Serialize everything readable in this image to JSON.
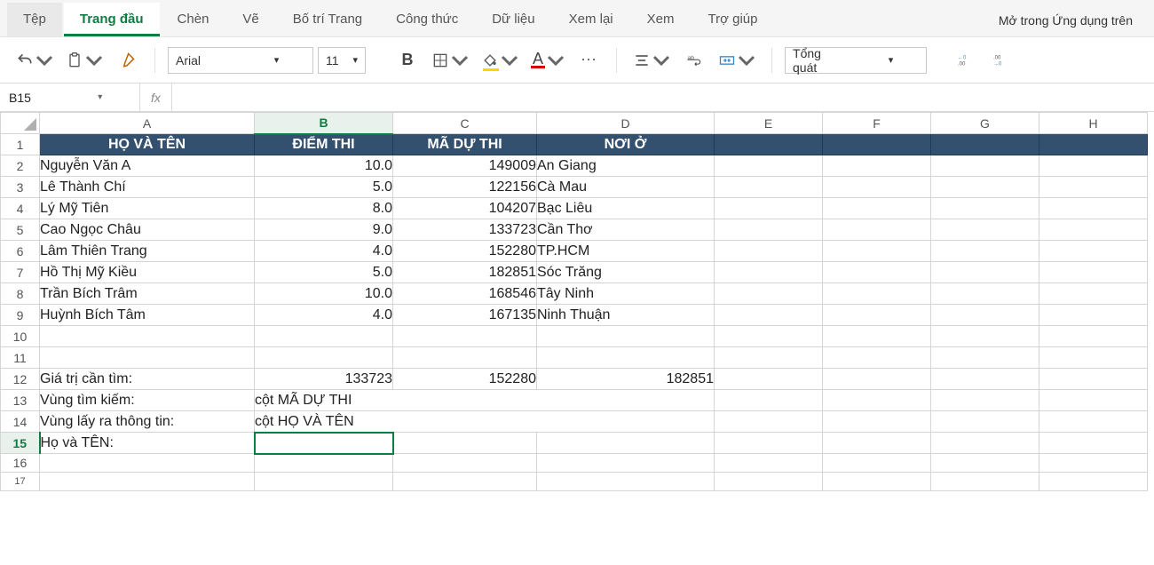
{
  "tabs": {
    "file": "Tệp",
    "home": "Trang đầu",
    "insert": "Chèn",
    "draw": "Vẽ",
    "layout": "Bố trí Trang",
    "formulas": "Công thức",
    "data": "Dữ liệu",
    "review": "Xem lại",
    "view": "Xem",
    "help": "Trợ giúp",
    "open_desktop": "Mở trong Ứng dụng trên"
  },
  "ribbon": {
    "font_name": "Arial",
    "font_size": "11",
    "number_format": "Tổng quát"
  },
  "namebox": "B15",
  "formula": "",
  "columns": [
    "A",
    "B",
    "C",
    "D",
    "E",
    "F",
    "G",
    "H"
  ],
  "row_count": 17,
  "selected_col": "B",
  "selected_row": 15,
  "header": {
    "A": "HỌ VÀ TÊN",
    "B": "ĐIỂM THI",
    "C": "MÃ DỰ THI",
    "D": "NƠI Ở"
  },
  "records": [
    {
      "name": "Nguyễn Văn A",
      "score": "10.0",
      "code": "149009",
      "place": "An Giang"
    },
    {
      "name": "Lê Thành Chí",
      "score": "5.0",
      "code": "122156",
      "place": "Cà Mau"
    },
    {
      "name": "Lý Mỹ Tiên",
      "score": "8.0",
      "code": "104207",
      "place": "Bạc Liêu"
    },
    {
      "name": "Cao Ngọc Châu",
      "score": "9.0",
      "code": "133723",
      "place": "Cần Thơ"
    },
    {
      "name": "Lâm Thiên Trang",
      "score": "4.0",
      "code": "152280",
      "place": "TP.HCM"
    },
    {
      "name": "Hồ Thị Mỹ Kiều",
      "score": "5.0",
      "code": "182851",
      "place": "Sóc Trăng"
    },
    {
      "name": "Trần Bích Trâm",
      "score": "10.0",
      "code": "168546",
      "place": "Tây Ninh"
    },
    {
      "name": "Huỳnh Bích Tâm",
      "score": "4.0",
      "code": "167135",
      "place": "Ninh Thuận"
    }
  ],
  "lookup": {
    "row12": {
      "A": "Giá trị cần tìm:",
      "B": "133723",
      "C": "152280",
      "D": "182851"
    },
    "row13": {
      "A": "Vùng tìm kiếm:",
      "B": "cột MÃ DỰ THI"
    },
    "row14": {
      "A": "Vùng lấy ra thông tin:",
      "B": "cột HỌ VÀ TÊN"
    },
    "row15": {
      "A": "Họ và TÊN:"
    }
  }
}
